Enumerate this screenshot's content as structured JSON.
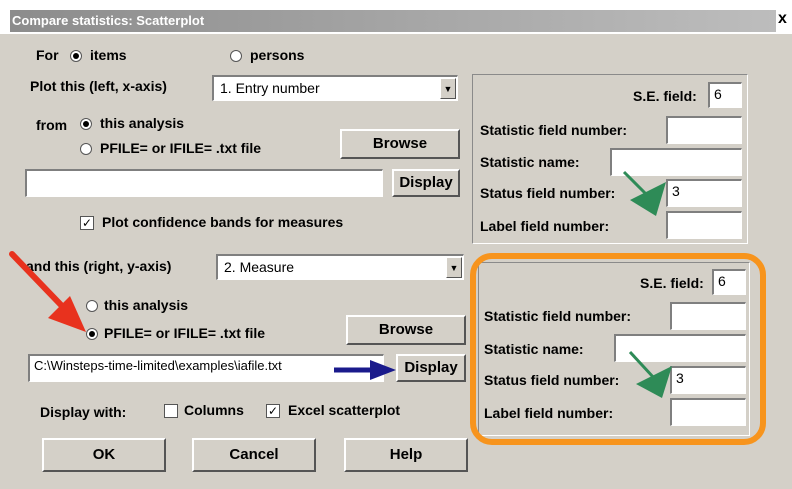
{
  "window": {
    "title": "Compare statistics: Scatterplot",
    "close_glyph": "x"
  },
  "for_row": {
    "label": "For",
    "items_label": "items",
    "items_selected": true,
    "persons_label": "persons",
    "persons_selected": false
  },
  "x_axis": {
    "plot_label": "Plot this (left, x-axis)",
    "selected": "1. Entry number",
    "from_label": "from",
    "this_analysis_label": "this analysis",
    "this_analysis_selected": true,
    "pfile_label": "PFILE= or IFILE= .txt file",
    "pfile_selected": false,
    "browse_label": "Browse",
    "path_value": "",
    "display_label": "Display"
  },
  "confidence": {
    "label": "Plot confidence bands for measures",
    "checked": true
  },
  "y_axis": {
    "plot_label": "and this (right, y-axis)",
    "selected": "2. Measure",
    "this_analysis_label": "this analysis",
    "this_analysis_selected": false,
    "pfile_label": "PFILE= or IFILE= .txt file",
    "pfile_selected": true,
    "browse_label": "Browse",
    "path_value": "C:\\Winsteps-time-limited\\examples\\iafile.txt",
    "display_label": "Display"
  },
  "x_fields": {
    "se_label": "S.E. field:",
    "se_value": "6",
    "stat_num_label": "Statistic field number:",
    "stat_num_value": "",
    "stat_name_label": "Statistic name:",
    "stat_name_value": "",
    "status_label": "Status field number:",
    "status_value": "3",
    "label_field_label": "Label field number:",
    "label_field_value": ""
  },
  "y_fields": {
    "se_label": "S.E. field:",
    "se_value": "6",
    "stat_num_label": "Statistic field number:",
    "stat_num_value": "",
    "stat_name_label": "Statistic name:",
    "stat_name_value": "",
    "status_label": "Status field number:",
    "status_value": "3",
    "label_field_label": "Label field number:",
    "label_field_value": ""
  },
  "display_with": {
    "label": "Display with:",
    "columns_label": "Columns",
    "columns_checked": false,
    "excel_label": "Excel scatterplot",
    "excel_checked": true
  },
  "buttons": {
    "ok": "OK",
    "cancel": "Cancel",
    "help": "Help"
  },
  "colors": {
    "highlight_box": "#f7941d",
    "red_arrow": "#e8321e",
    "green_arrow": "#2e8b57",
    "blue_arrow": "#1a1a8c"
  },
  "icons": {
    "dropdown": "chevron-down-icon",
    "check": "checkmark-icon"
  }
}
